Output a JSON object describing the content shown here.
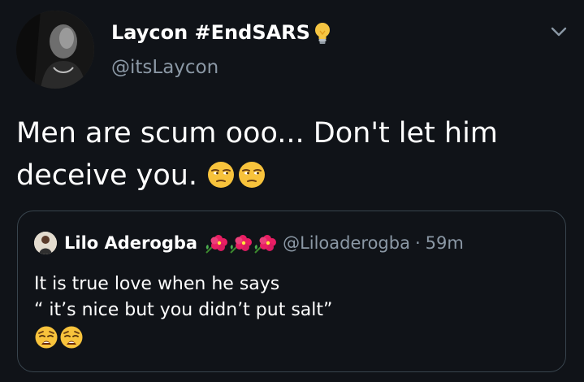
{
  "tweet": {
    "author": {
      "display_name": "Laycon #EndSARS",
      "badge_icon": "light-bulb-icon",
      "handle": "@itsLaycon"
    },
    "menu_icon": "chevron-down-icon",
    "text_lines": [
      "Men are scum ooo... Don't let him",
      "deceive you."
    ],
    "emojis": [
      "unamused-face-icon",
      "unamused-face-icon"
    ],
    "quoted_tweet": {
      "author_name": "Lilo Aderogba",
      "name_decoration_icons": [
        "hibiscus-icon",
        "hibiscus-icon",
        "hibiscus-icon"
      ],
      "handle": "@Liloaderogba",
      "separator": "·",
      "time": "59m",
      "text_lines": [
        "It is true love when he says",
        "“ it’s nice but you didn’t put salt”"
      ],
      "emojis": [
        "weary-face-icon",
        "weary-face-icon"
      ]
    }
  },
  "colors": {
    "background": "#101318",
    "primary_text": "#ffffff",
    "secondary_text": "#8b98a5",
    "card_border": "#38444d"
  }
}
